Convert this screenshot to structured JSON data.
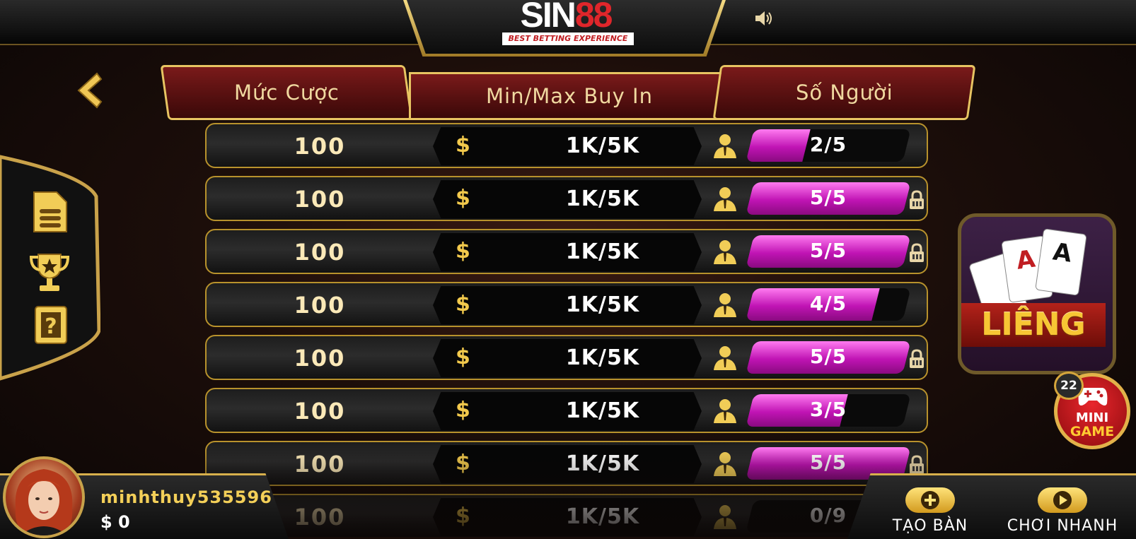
{
  "header": {
    "logo_word": "SIN",
    "logo_number": "88",
    "logo_tagline": "BEST BETTING EXPERIENCE"
  },
  "table_headers": {
    "bet": "Mức Cược",
    "buyin": "Min/Max Buy In",
    "players": "Số Người"
  },
  "rows": [
    {
      "bet": "100",
      "buyin": "1K/5K",
      "players": "2/5",
      "fill": 0.36,
      "locked": false
    },
    {
      "bet": "100",
      "buyin": "1K/5K",
      "players": "5/5",
      "fill": 1.0,
      "locked": true
    },
    {
      "bet": "100",
      "buyin": "1K/5K",
      "players": "5/5",
      "fill": 1.0,
      "locked": true
    },
    {
      "bet": "100",
      "buyin": "1K/5K",
      "players": "4/5",
      "fill": 0.8,
      "locked": false
    },
    {
      "bet": "100",
      "buyin": "1K/5K",
      "players": "5/5",
      "fill": 1.0,
      "locked": true
    },
    {
      "bet": "100",
      "buyin": "1K/5K",
      "players": "3/5",
      "fill": 0.6,
      "locked": false
    },
    {
      "bet": "100",
      "buyin": "1K/5K",
      "players": "5/5",
      "fill": 1.0,
      "locked": true
    },
    {
      "bet": "100",
      "buyin": "1K/5K",
      "players": "0/9",
      "fill": 0.0,
      "locked": false
    }
  ],
  "currency_symbol": "$",
  "game_card": {
    "title": "LIÊNG",
    "card_rank": "A"
  },
  "mini_game": {
    "badge": "22",
    "line1": "MINI",
    "line2": "GAME"
  },
  "user": {
    "name": "minhthuy535596",
    "balance": "$ 0"
  },
  "actions": {
    "create_table": "TẠO BÀN",
    "quick_play": "CHƠI NHANH"
  },
  "colors": {
    "gold": "#e8c462",
    "magenta": "#c014b4",
    "tab_red": "#7a1a1a"
  }
}
